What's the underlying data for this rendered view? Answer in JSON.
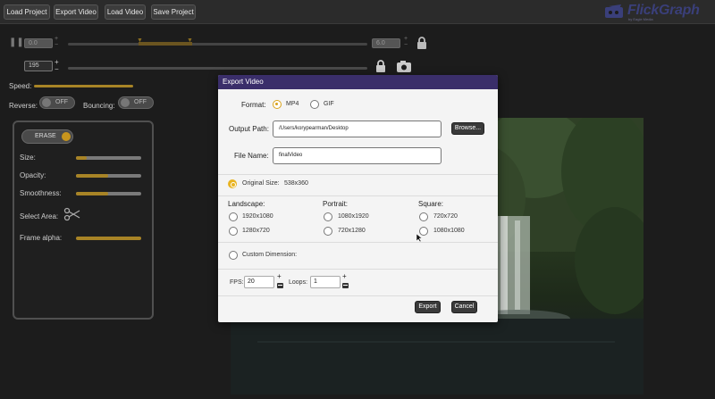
{
  "toolbar": {
    "load_project": "Load Project",
    "export_video": "Export Video",
    "load_video": "Load Video",
    "save_project": "Save Project"
  },
  "brand": {
    "name": "FlickGraph",
    "sub": "by Eagle Media"
  },
  "timeline": {
    "start_value": "195",
    "dim_left": "0.0",
    "dim_right": "6.0"
  },
  "controls": {
    "speed_label": "Speed:",
    "reverse_label": "Reverse:",
    "reverse_state": "OFF",
    "bouncing_label": "Bouncing:",
    "bouncing_state": "OFF"
  },
  "erase_panel": {
    "erase_label": "ERASE",
    "size_label": "Size:",
    "opacity_label": "Opacity:",
    "smoothness_label": "Smoothness:",
    "select_area_label": "Select Area:",
    "frame_alpha_label": "Frame alpha:"
  },
  "dialog": {
    "title": "Export Video",
    "format_label": "Format:",
    "format_options": [
      "MP4",
      "GIF"
    ],
    "format_selected": "MP4",
    "output_path_label": "Output Path:",
    "output_path_value": "/Users/korypearman/Desktop",
    "browse_label": "Browse...",
    "file_name_label": "File Name:",
    "file_name_value": "finalVideo",
    "original_size_label": "Original Size:",
    "original_size_value": "538x360",
    "landscape_label": "Landscape:",
    "landscape_options": [
      "1920x1080",
      "1280x720"
    ],
    "portrait_label": "Portrait:",
    "portrait_options": [
      "1080x1920",
      "720x1280"
    ],
    "square_label": "Square:",
    "square_options": [
      "720x720",
      "1080x1080"
    ],
    "custom_dimension_label": "Custom Dimension:",
    "fps_label": "FPS:",
    "fps_value": "20",
    "loops_label": "Loops:",
    "loops_value": "1",
    "export_label": "Export",
    "cancel_label": "Cancel"
  },
  "colors": {
    "accent": "#d9a21b",
    "dialog_header": "#3a2e6a",
    "brand": "#3a3f7a"
  },
  "icons": [
    "pause-icon",
    "lock-icon",
    "camera-icon",
    "scissors-icon",
    "cursor-icon"
  ]
}
